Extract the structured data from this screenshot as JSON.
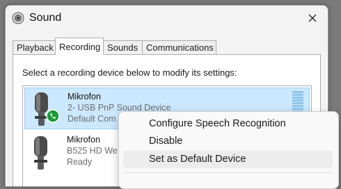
{
  "window": {
    "title": "Sound",
    "icon": "speaker-icon"
  },
  "tabs": [
    {
      "label": "Playback"
    },
    {
      "label": "Recording"
    },
    {
      "label": "Sounds"
    },
    {
      "label": "Communications"
    }
  ],
  "active_tab": "Recording",
  "instruction": "Select a recording device below to modify its settings:",
  "devices": [
    {
      "name": "Mikrofon",
      "description": "2- USB PnP Sound Device",
      "status": "Default Com",
      "selected": true,
      "badge": "phone-icon",
      "badge_color": "#1f9c3a"
    },
    {
      "name": "Mikrofon",
      "description": "B525 HD We",
      "status": "Ready",
      "selected": false
    }
  ],
  "context_menu": {
    "items": [
      {
        "label": "Configure Speech Recognition"
      },
      {
        "label": "Disable"
      },
      {
        "label": "Set as Default Device",
        "highlighted": true
      }
    ]
  },
  "colors": {
    "selection_bg": "#cce8ff",
    "selection_border": "#99d1ff",
    "level_meter": "#8fc6ea"
  }
}
